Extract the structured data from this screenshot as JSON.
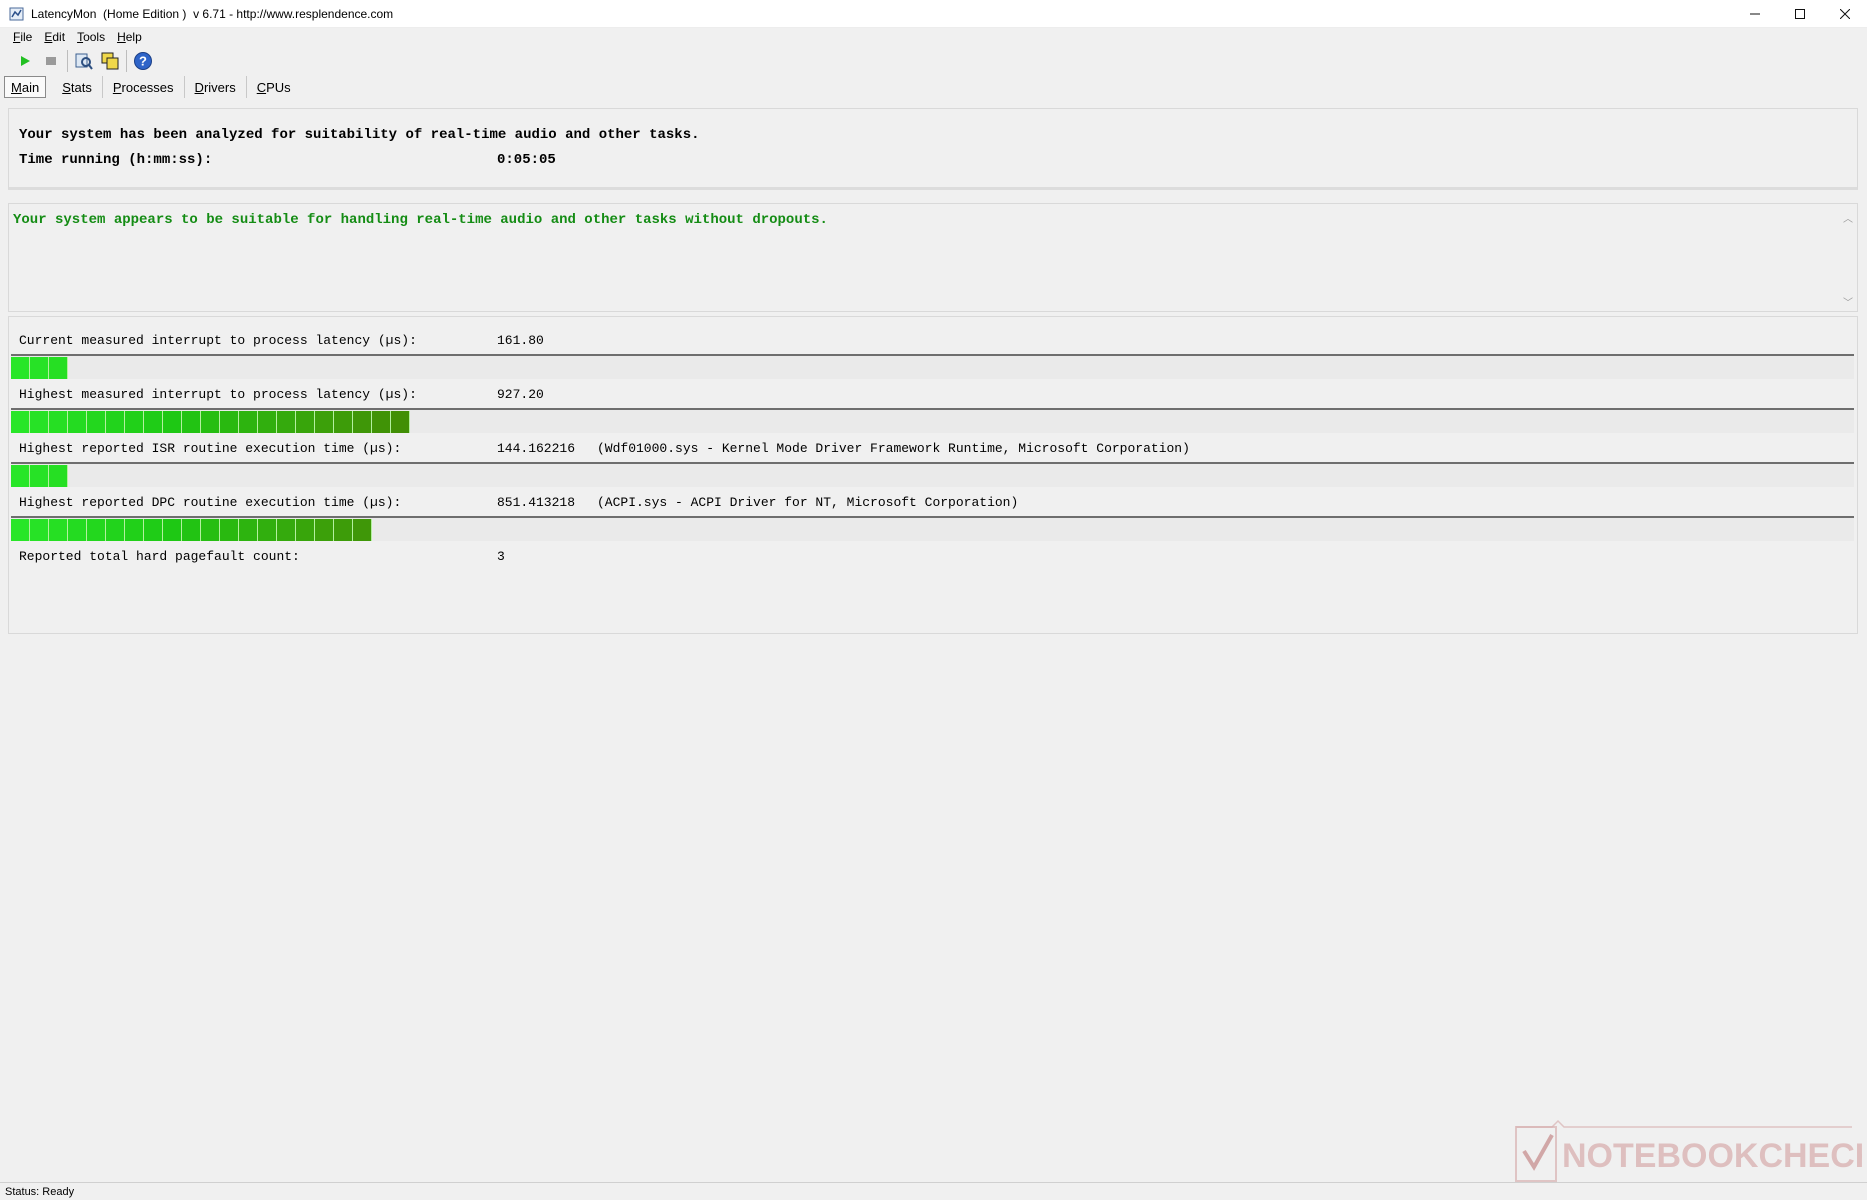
{
  "window": {
    "title": "LatencyMon  (Home Edition )  v 6.71 - http://www.resplendence.com",
    "controls": [
      "minimize",
      "maximize",
      "close"
    ]
  },
  "menu": {
    "items": [
      {
        "underlined": "F",
        "rest": "ile"
      },
      {
        "underlined": "E",
        "rest": "dit"
      },
      {
        "underlined": "T",
        "rest": "ools"
      },
      {
        "underlined": "H",
        "rest": "elp"
      }
    ]
  },
  "toolbar": {
    "buttons": [
      "play-icon",
      "stop-icon",
      "report-icon",
      "windows-icon",
      "help-icon"
    ]
  },
  "tabs": [
    {
      "underlined": "M",
      "rest": "ain",
      "active": true
    },
    {
      "underlined": "S",
      "rest": "tats",
      "active": false
    },
    {
      "underlined": "P",
      "rest": "rocesses",
      "active": false
    },
    {
      "underlined": "D",
      "rest": "rivers",
      "active": false
    },
    {
      "underlined": "C",
      "rest": "PUs",
      "active": false
    }
  ],
  "summary": {
    "analyzed_text": "Your system has been analyzed for suitability of real-time audio and other tasks.",
    "time_label": "Time running (h:mm:ss):",
    "time_value": "0:05:05"
  },
  "verdict": {
    "text": "Your system appears to be suitable for handling real-time audio and other tasks without dropouts.",
    "color": "#148c14"
  },
  "metrics": [
    {
      "label": "Current measured interrupt to process latency (µs):",
      "value": "161.80",
      "note": "",
      "bar_fraction": 0.0347
    },
    {
      "label": "Highest measured interrupt to process latency (µs):",
      "value": "927.20",
      "note": "",
      "bar_fraction": 0.2173
    },
    {
      "label": "Highest reported ISR routine execution time (µs):",
      "value": "144.162216",
      "note": "(Wdf01000.sys - Kernel Mode Driver Framework Runtime, Microsoft Corporation)",
      "bar_fraction": 0.036
    },
    {
      "label": "Highest reported DPC routine execution time (µs):",
      "value": "851.413218",
      "note": "(ACPI.sys - ACPI Driver for NT, Microsoft Corporation)",
      "bar_fraction": 0.2005
    },
    {
      "label": "Reported total hard pagefault count:",
      "value": "3",
      "note": ""
    }
  ],
  "status": {
    "text": "Status: Ready"
  },
  "watermark": {
    "text": "NOTEBOOKCHECK"
  }
}
